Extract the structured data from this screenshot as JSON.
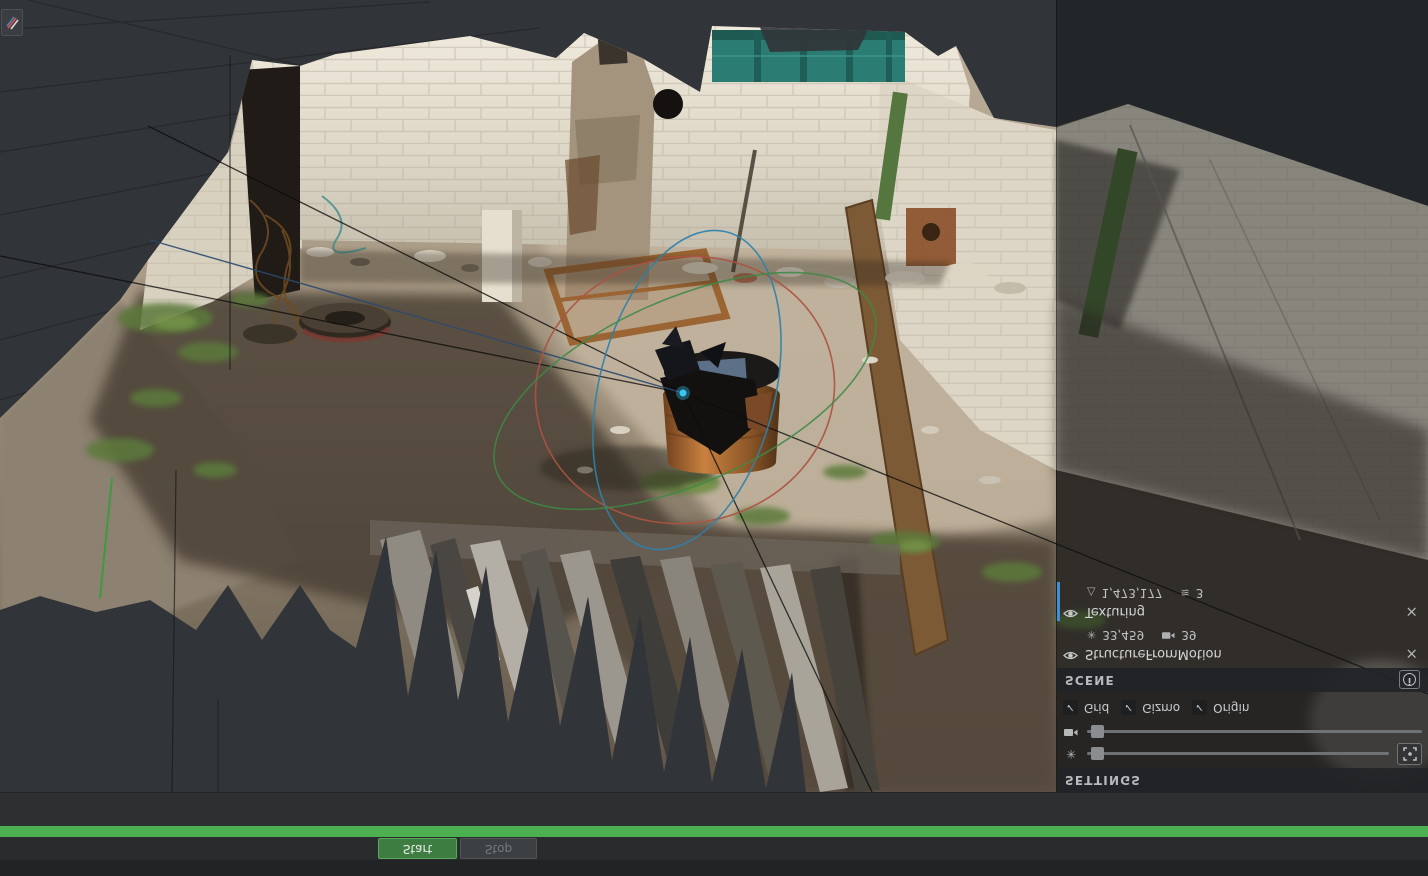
{
  "viewport": {
    "background_color": "#313438",
    "gizmo_colors": {
      "red": "#ad5242",
      "green": "#3d8a45",
      "blue": "#2f81ab"
    },
    "camera_point_color": "#39c6f2"
  },
  "inspector": {
    "settings": {
      "header": "SETTINGS"
    },
    "display_toggles": [
      {
        "label": "Grid",
        "checked": true
      },
      {
        "label": "Gizmo",
        "checked": true
      },
      {
        "label": "Origin",
        "checked": true
      }
    ],
    "sliders": [
      {
        "icon": "features-icon",
        "value_percent": 3,
        "has_center_button": true
      },
      {
        "icon": "camera-icon",
        "value_percent": 3
      }
    ],
    "scene": {
      "header": "SCENE"
    },
    "media": [
      {
        "label": "StructureFromMotion",
        "visible": true,
        "selected": false,
        "stats": [
          {
            "icon": "features-icon",
            "value": "33,459"
          },
          {
            "icon": "camera-icon",
            "value": "39"
          }
        ]
      },
      {
        "label": "Texturing",
        "visible": true,
        "selected": true,
        "stats": [
          {
            "icon": "faces-icon",
            "value": "1,473,177"
          },
          {
            "icon": "texture-icon",
            "value": "3"
          }
        ]
      }
    ],
    "selection_color": "#3f8fd6"
  },
  "taskbar": {
    "start_label": "Start",
    "stop_label": "Stop",
    "stop_enabled": false,
    "progress": {
      "value_percent": 100,
      "color": "#4caf50"
    }
  },
  "icons": {
    "check": "✓",
    "close": "×",
    "faces": "△",
    "texture": "≋",
    "features": "✳",
    "info": "i"
  }
}
